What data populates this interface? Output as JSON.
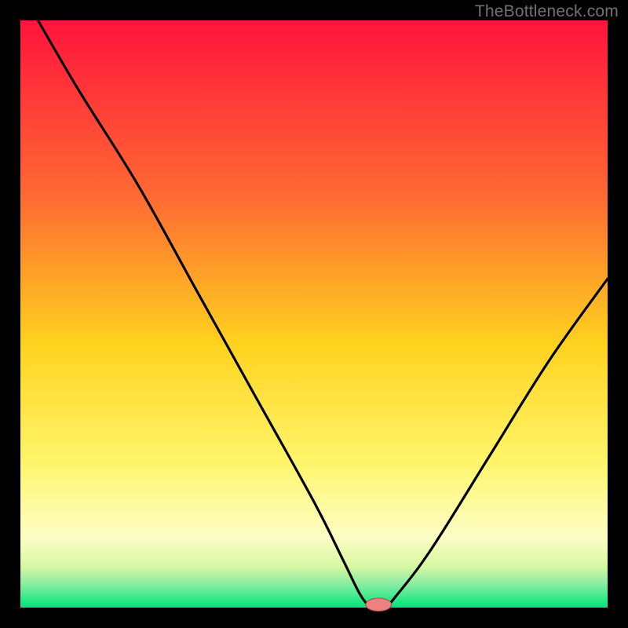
{
  "watermark": "TheBottleneck.com",
  "chart_data": {
    "type": "line",
    "title": "",
    "xlabel": "",
    "ylabel": "",
    "xlim": [
      0,
      100
    ],
    "ylim": [
      0,
      100
    ],
    "x": [
      3,
      10,
      20,
      30,
      40,
      50,
      55,
      58,
      60,
      62,
      64,
      70,
      80,
      90,
      100
    ],
    "values": [
      100,
      88,
      72,
      54,
      36,
      18,
      8,
      2,
      0,
      0,
      2,
      10,
      26,
      42,
      56
    ],
    "marker": {
      "x": 61,
      "y": 0.5,
      "color": "#f08080",
      "rx": 2.2,
      "ry": 1.1
    },
    "gradient_stops": [
      {
        "offset": 0.0,
        "color": "#ff143c"
      },
      {
        "offset": 0.3,
        "color": "#ff6a33"
      },
      {
        "offset": 0.55,
        "color": "#ffd21e"
      },
      {
        "offset": 0.75,
        "color": "#fff56a"
      },
      {
        "offset": 0.88,
        "color": "#fdfec5"
      },
      {
        "offset": 0.93,
        "color": "#d7f7a2"
      },
      {
        "offset": 0.96,
        "color": "#88eda2"
      },
      {
        "offset": 1.0,
        "color": "#00e67a"
      }
    ],
    "background_frame_color": "#000000"
  }
}
